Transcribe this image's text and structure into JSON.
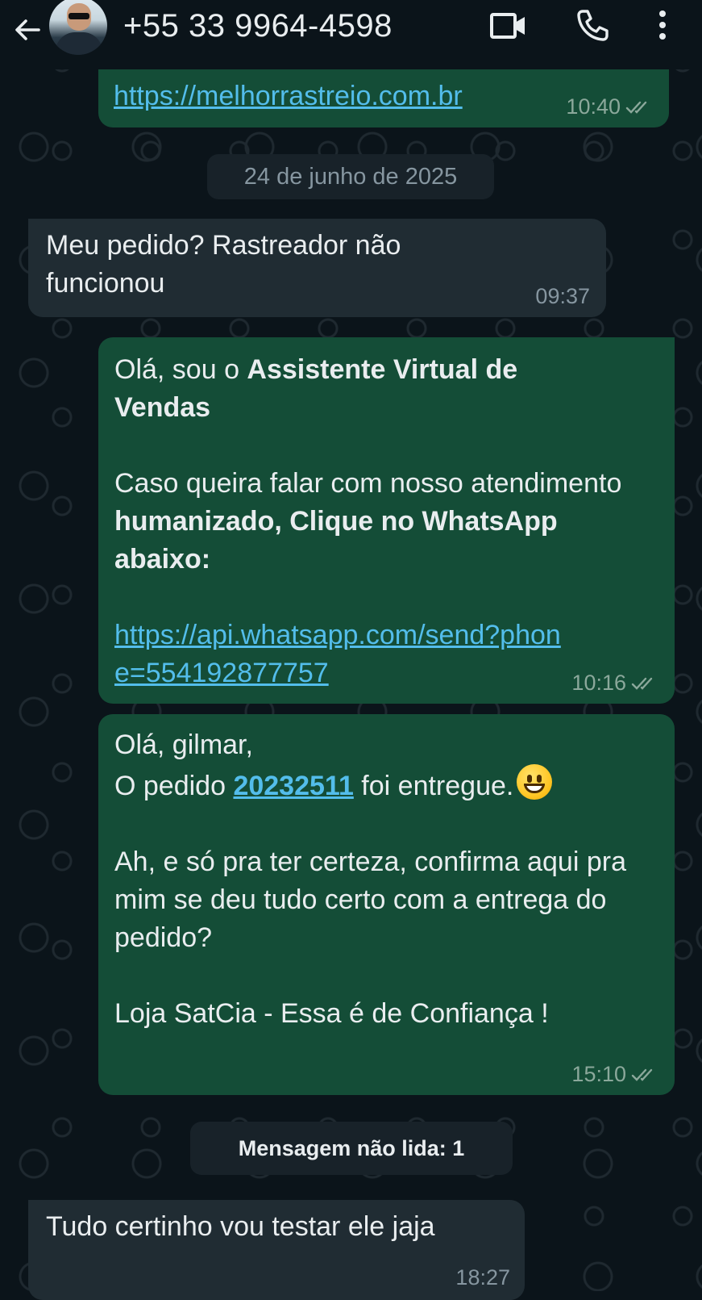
{
  "header": {
    "contact_name": "+55 33 9964-4598",
    "icons": [
      "back-arrow-icon",
      "video-call-icon",
      "voice-call-icon",
      "more-options-icon"
    ]
  },
  "messages": [
    {
      "id": "m1",
      "direction": "outgoing",
      "link": "https://melhorrastreio.com.br",
      "time": "10:40",
      "status": "delivered"
    },
    {
      "id": "m3",
      "direction": "incoming",
      "text": "Meu pedido? Rastreador não funcionou",
      "time": "09:37"
    },
    {
      "id": "m4",
      "direction": "outgoing",
      "p1_plain": "Olá, sou o ",
      "p1_bold": "Assistente Virtual de Vendas",
      "p2_plain": "Caso queira falar com nosso atendimento ",
      "p2_bold": "humanizado, Clique no WhatsApp abaixo:",
      "link": "https://api.whatsapp.com/send?phone=554192877757",
      "time": "10:16",
      "status": "delivered"
    },
    {
      "id": "m5",
      "direction": "outgoing",
      "greeting": "Olá, gilmar,",
      "order_prefix": "O pedido ",
      "order_number": "20232511",
      "order_suffix": " foi entregue.",
      "emoji": "grinning-face",
      "question": "Ah, e só pra ter certeza, confirma aqui pra mim se deu tudo certo com a entrega do pedido?",
      "signature": "Loja SatCia - Essa é de Confiança !",
      "time": "15:10",
      "status": "delivered"
    },
    {
      "id": "m6",
      "direction": "incoming",
      "text": "Tudo certinho vou testar ele jaja",
      "time": "18:27"
    }
  ],
  "date_separator": "24 de junho de 2025",
  "unread_banner": "Mensagem não lida: 1",
  "colors": {
    "background": "#0b141a",
    "outgoing_bubble": "#144d37",
    "incoming_bubble": "#202c33",
    "link": "#53bdeb",
    "tick_delivered": "#8ba89b"
  }
}
